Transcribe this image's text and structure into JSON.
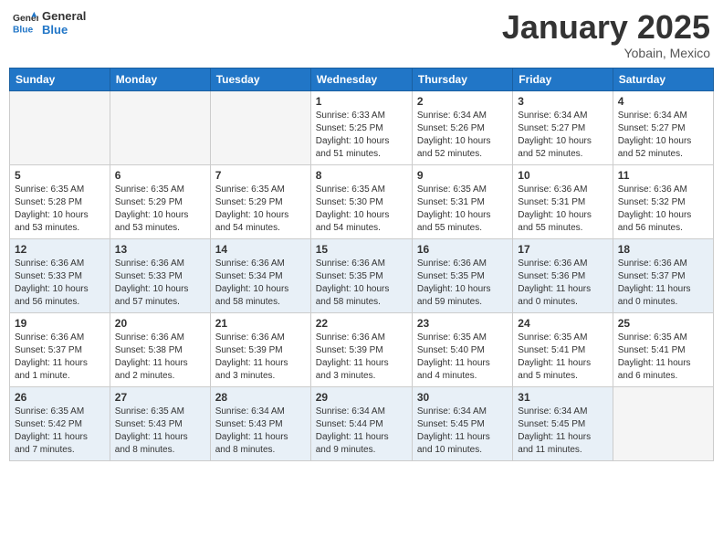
{
  "header": {
    "logo_line1": "General",
    "logo_line2": "Blue",
    "month": "January 2025",
    "location": "Yobain, Mexico"
  },
  "weekdays": [
    "Sunday",
    "Monday",
    "Tuesday",
    "Wednesday",
    "Thursday",
    "Friday",
    "Saturday"
  ],
  "weeks": [
    [
      {
        "day": "",
        "content": ""
      },
      {
        "day": "",
        "content": ""
      },
      {
        "day": "",
        "content": ""
      },
      {
        "day": "1",
        "content": "Sunrise: 6:33 AM\nSunset: 5:25 PM\nDaylight: 10 hours\nand 51 minutes."
      },
      {
        "day": "2",
        "content": "Sunrise: 6:34 AM\nSunset: 5:26 PM\nDaylight: 10 hours\nand 52 minutes."
      },
      {
        "day": "3",
        "content": "Sunrise: 6:34 AM\nSunset: 5:27 PM\nDaylight: 10 hours\nand 52 minutes."
      },
      {
        "day": "4",
        "content": "Sunrise: 6:34 AM\nSunset: 5:27 PM\nDaylight: 10 hours\nand 52 minutes."
      }
    ],
    [
      {
        "day": "5",
        "content": "Sunrise: 6:35 AM\nSunset: 5:28 PM\nDaylight: 10 hours\nand 53 minutes."
      },
      {
        "day": "6",
        "content": "Sunrise: 6:35 AM\nSunset: 5:29 PM\nDaylight: 10 hours\nand 53 minutes."
      },
      {
        "day": "7",
        "content": "Sunrise: 6:35 AM\nSunset: 5:29 PM\nDaylight: 10 hours\nand 54 minutes."
      },
      {
        "day": "8",
        "content": "Sunrise: 6:35 AM\nSunset: 5:30 PM\nDaylight: 10 hours\nand 54 minutes."
      },
      {
        "day": "9",
        "content": "Sunrise: 6:35 AM\nSunset: 5:31 PM\nDaylight: 10 hours\nand 55 minutes."
      },
      {
        "day": "10",
        "content": "Sunrise: 6:36 AM\nSunset: 5:31 PM\nDaylight: 10 hours\nand 55 minutes."
      },
      {
        "day": "11",
        "content": "Sunrise: 6:36 AM\nSunset: 5:32 PM\nDaylight: 10 hours\nand 56 minutes."
      }
    ],
    [
      {
        "day": "12",
        "content": "Sunrise: 6:36 AM\nSunset: 5:33 PM\nDaylight: 10 hours\nand 56 minutes."
      },
      {
        "day": "13",
        "content": "Sunrise: 6:36 AM\nSunset: 5:33 PM\nDaylight: 10 hours\nand 57 minutes."
      },
      {
        "day": "14",
        "content": "Sunrise: 6:36 AM\nSunset: 5:34 PM\nDaylight: 10 hours\nand 58 minutes."
      },
      {
        "day": "15",
        "content": "Sunrise: 6:36 AM\nSunset: 5:35 PM\nDaylight: 10 hours\nand 58 minutes."
      },
      {
        "day": "16",
        "content": "Sunrise: 6:36 AM\nSunset: 5:35 PM\nDaylight: 10 hours\nand 59 minutes."
      },
      {
        "day": "17",
        "content": "Sunrise: 6:36 AM\nSunset: 5:36 PM\nDaylight: 11 hours\nand 0 minutes."
      },
      {
        "day": "18",
        "content": "Sunrise: 6:36 AM\nSunset: 5:37 PM\nDaylight: 11 hours\nand 0 minutes."
      }
    ],
    [
      {
        "day": "19",
        "content": "Sunrise: 6:36 AM\nSunset: 5:37 PM\nDaylight: 11 hours\nand 1 minute."
      },
      {
        "day": "20",
        "content": "Sunrise: 6:36 AM\nSunset: 5:38 PM\nDaylight: 11 hours\nand 2 minutes."
      },
      {
        "day": "21",
        "content": "Sunrise: 6:36 AM\nSunset: 5:39 PM\nDaylight: 11 hours\nand 3 minutes."
      },
      {
        "day": "22",
        "content": "Sunrise: 6:36 AM\nSunset: 5:39 PM\nDaylight: 11 hours\nand 3 minutes."
      },
      {
        "day": "23",
        "content": "Sunrise: 6:35 AM\nSunset: 5:40 PM\nDaylight: 11 hours\nand 4 minutes."
      },
      {
        "day": "24",
        "content": "Sunrise: 6:35 AM\nSunset: 5:41 PM\nDaylight: 11 hours\nand 5 minutes."
      },
      {
        "day": "25",
        "content": "Sunrise: 6:35 AM\nSunset: 5:41 PM\nDaylight: 11 hours\nand 6 minutes."
      }
    ],
    [
      {
        "day": "26",
        "content": "Sunrise: 6:35 AM\nSunset: 5:42 PM\nDaylight: 11 hours\nand 7 minutes."
      },
      {
        "day": "27",
        "content": "Sunrise: 6:35 AM\nSunset: 5:43 PM\nDaylight: 11 hours\nand 8 minutes."
      },
      {
        "day": "28",
        "content": "Sunrise: 6:34 AM\nSunset: 5:43 PM\nDaylight: 11 hours\nand 8 minutes."
      },
      {
        "day": "29",
        "content": "Sunrise: 6:34 AM\nSunset: 5:44 PM\nDaylight: 11 hours\nand 9 minutes."
      },
      {
        "day": "30",
        "content": "Sunrise: 6:34 AM\nSunset: 5:45 PM\nDaylight: 11 hours\nand 10 minutes."
      },
      {
        "day": "31",
        "content": "Sunrise: 6:34 AM\nSunset: 5:45 PM\nDaylight: 11 hours\nand 11 minutes."
      },
      {
        "day": "",
        "content": ""
      }
    ]
  ]
}
